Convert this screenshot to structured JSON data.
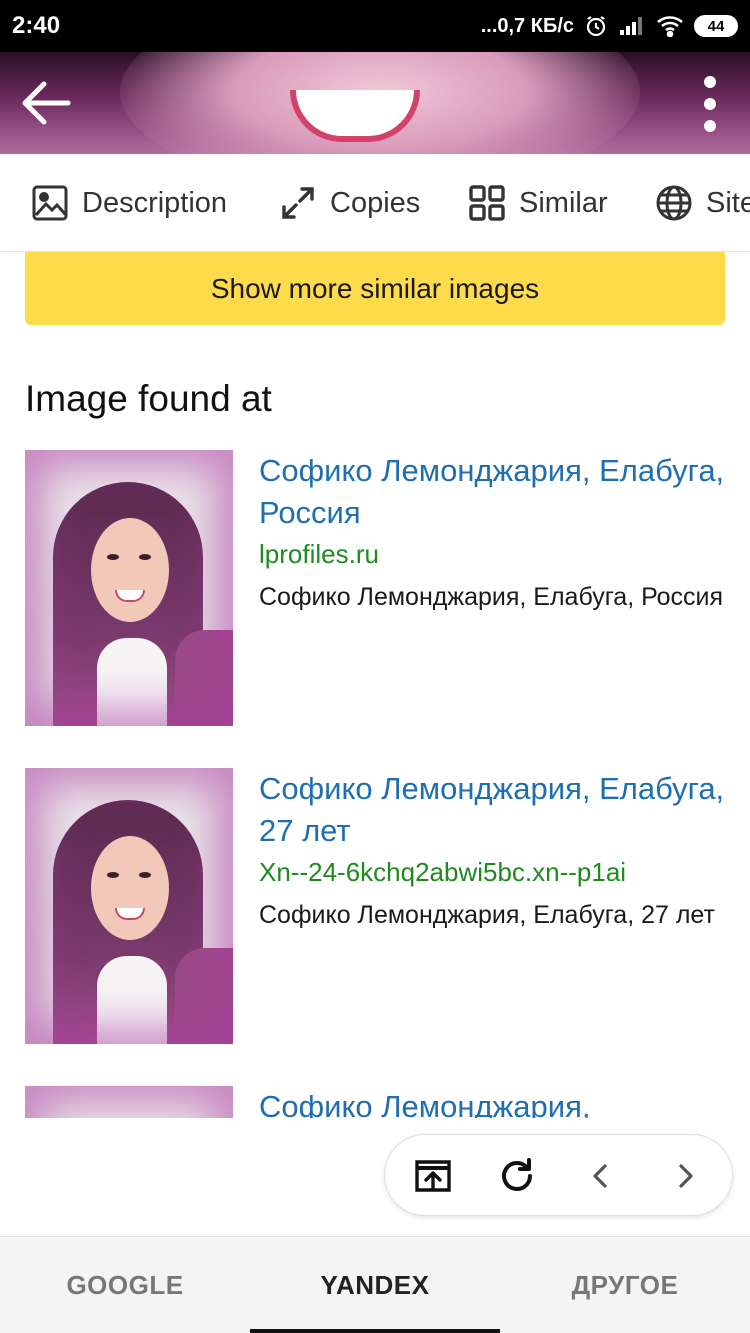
{
  "status_bar": {
    "time": "2:40",
    "network_speed": "...0,7 КБ/с",
    "battery": "44"
  },
  "icons": {
    "back": "arrow-left-icon",
    "menu": "more-vert-icon",
    "description": "image-icon",
    "copies": "expand-icon",
    "similar": "grid-icon",
    "sites": "globe-icon",
    "open_external": "open-in-new-icon",
    "reload": "refresh-icon",
    "prev": "chevron-left-icon",
    "next": "chevron-right-icon"
  },
  "tabs": [
    {
      "label": "Description"
    },
    {
      "label": "Copies"
    },
    {
      "label": "Similar"
    },
    {
      "label": "Site"
    }
  ],
  "more_button": "Show more similar images",
  "section_title": "Image found at",
  "results": [
    {
      "title": "Софико Лемонджария, Елабуга, Россия",
      "domain": "lprofiles.ru",
      "description": "Софико Лемонджария, Елабуга, Россия"
    },
    {
      "title": "Софико Лемонджария, Елабуга, 27 лет",
      "domain": "Xn--24-6kchq2abwi5bc.xn--p1ai",
      "description": "Софико Лемонджария, Елабуга, 27 лет"
    },
    {
      "title": "Софико Лемонджария,",
      "domain": "",
      "description": ""
    }
  ],
  "bottom_tabs": [
    {
      "label": "GOOGLE",
      "active": false
    },
    {
      "label": "YANDEX",
      "active": true
    },
    {
      "label": "ДРУГОЕ",
      "active": false
    }
  ],
  "colors": {
    "link": "#1f6fb0",
    "domain": "#1f8a1f",
    "button": "#fddb4a"
  }
}
